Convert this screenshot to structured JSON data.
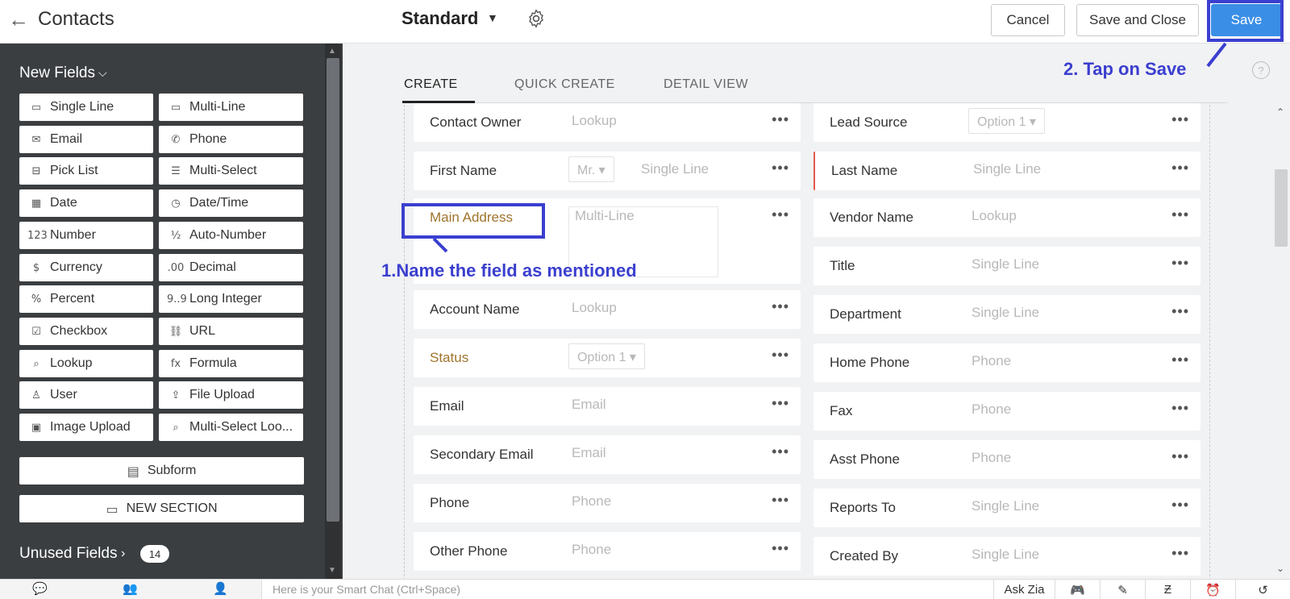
{
  "header": {
    "back_icon": "arrow-left-icon",
    "title": "Contacts",
    "layout_name": "Standard",
    "cancel_label": "Cancel",
    "save_close_label": "Save and Close",
    "save_label": "Save"
  },
  "sidebar": {
    "heading": "New Fields",
    "fields": [
      {
        "label": "Single Line",
        "icon": "single-line-icon",
        "glyph": "▭"
      },
      {
        "label": "Multi-Line",
        "icon": "multi-line-icon",
        "glyph": "▭"
      },
      {
        "label": "Email",
        "icon": "email-icon",
        "glyph": "✉"
      },
      {
        "label": "Phone",
        "icon": "phone-icon",
        "glyph": "✆"
      },
      {
        "label": "Pick List",
        "icon": "picklist-icon",
        "glyph": "⊟"
      },
      {
        "label": "Multi-Select",
        "icon": "multi-select-icon",
        "glyph": "☰"
      },
      {
        "label": "Date",
        "icon": "date-icon",
        "glyph": "▦"
      },
      {
        "label": "Date/Time",
        "icon": "date-time-icon",
        "glyph": "◷"
      },
      {
        "label": "Number",
        "icon": "number-icon",
        "glyph": "123"
      },
      {
        "label": "Auto-Number",
        "icon": "auto-number-icon",
        "glyph": "½"
      },
      {
        "label": "Currency",
        "icon": "currency-icon",
        "glyph": "$"
      },
      {
        "label": "Decimal",
        "icon": "decimal-icon",
        "glyph": ".00"
      },
      {
        "label": "Percent",
        "icon": "percent-icon",
        "glyph": "%"
      },
      {
        "label": "Long Integer",
        "icon": "long-integer-icon",
        "glyph": "9..9"
      },
      {
        "label": "Checkbox",
        "icon": "checkbox-icon",
        "glyph": "☑"
      },
      {
        "label": "URL",
        "icon": "url-icon",
        "glyph": "⛓"
      },
      {
        "label": "Lookup",
        "icon": "lookup-icon",
        "glyph": "⌕"
      },
      {
        "label": "Formula",
        "icon": "formula-icon",
        "glyph": "fx"
      },
      {
        "label": "User",
        "icon": "user-icon",
        "glyph": "♙"
      },
      {
        "label": "File Upload",
        "icon": "file-upload-icon",
        "glyph": "⇪"
      },
      {
        "label": "Image Upload",
        "icon": "image-upload-icon",
        "glyph": "▣"
      },
      {
        "label": "Multi-Select Loo...",
        "icon": "multi-select-lookup-icon",
        "glyph": "⌕"
      }
    ],
    "subform_label": "Subform",
    "new_section_label": "NEW SECTION",
    "unused_label": "Unused Fields",
    "unused_count": "14"
  },
  "tabs": [
    {
      "label": "CREATE",
      "active": true
    },
    {
      "label": "QUICK CREATE",
      "active": false
    },
    {
      "label": "DETAIL VIEW",
      "active": false
    }
  ],
  "left_fields": [
    {
      "label": "Contact Owner",
      "placeholder": "Lookup"
    },
    {
      "label": "First Name",
      "dropdown": "Mr.",
      "placeholder": "Single Line"
    },
    {
      "label": "Main Address",
      "placeholder": "Multi-Line"
    },
    {
      "label": "Account Name",
      "placeholder": "Lookup"
    },
    {
      "label": "Status",
      "dropdown": "Option 1"
    },
    {
      "label": "Email",
      "placeholder": "Email"
    },
    {
      "label": "Secondary Email",
      "placeholder": "Email"
    },
    {
      "label": "Phone",
      "placeholder": "Phone"
    },
    {
      "label": "Other Phone",
      "placeholder": "Phone"
    }
  ],
  "right_fields": [
    {
      "label": "Lead Source",
      "dropdown": "Option 1"
    },
    {
      "label": "Last Name",
      "placeholder": "Single Line"
    },
    {
      "label": "Vendor Name",
      "placeholder": "Lookup"
    },
    {
      "label": "Title",
      "placeholder": "Single Line"
    },
    {
      "label": "Department",
      "placeholder": "Single Line"
    },
    {
      "label": "Home Phone",
      "placeholder": "Phone"
    },
    {
      "label": "Fax",
      "placeholder": "Phone"
    },
    {
      "label": "Asst Phone",
      "placeholder": "Phone"
    },
    {
      "label": "Reports To",
      "placeholder": "Single Line"
    },
    {
      "label": "Created By",
      "placeholder": "Single Line"
    }
  ],
  "annotations": {
    "step1": "1.Name the field as mentioned",
    "step2": "2. Tap on Save"
  },
  "bottom_bar": {
    "chat_placeholder": "Here is your Smart Chat (Ctrl+Space)",
    "ask_zia": "Ask Zia"
  },
  "colors": {
    "accent": "#3a8ee6",
    "annotation": "#3b3fcf",
    "sidebar_bg": "#3b3e41",
    "mandatory": "#e3574b",
    "highlight_label": "#a0742c"
  }
}
